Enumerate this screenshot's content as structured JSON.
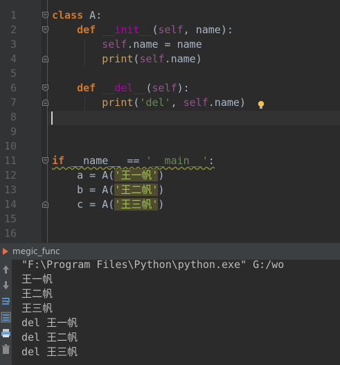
{
  "editor": {
    "line_numbers": [
      "1",
      "2",
      "3",
      "4",
      "5",
      "6",
      "7",
      "8",
      "9",
      "10",
      "11",
      "12",
      "13",
      "14",
      "15",
      "16"
    ],
    "line1": {
      "kw": "class",
      "rest": " A:"
    },
    "line2": {
      "kw": "def",
      "sp": " ",
      "magic": "__init__",
      "p1": "(",
      "self": "self",
      "rest": ", name):"
    },
    "line3": {
      "self": "self",
      "rest": ".name = name"
    },
    "line4": {
      "bi": "print",
      "p1": "(",
      "self": "self",
      "rest": ".name)"
    },
    "line6": {
      "kw": "def",
      "sp": " ",
      "magic": "__del__",
      "p1": "(",
      "self": "self",
      "rest": "):"
    },
    "line7": {
      "bi": "print",
      "p1": "(",
      "str": "'del'",
      "p2": ", ",
      "self": "self",
      "rest": ".name)"
    },
    "line11": {
      "kw": "if",
      "sp": " ",
      "dname": "__name__",
      "op": " == ",
      "str": "'__main__'",
      "rest": ":"
    },
    "line12": {
      "pre": "a = A(",
      "str": "'王一帆'",
      "rest": ")"
    },
    "line13": {
      "pre": "b = A(",
      "str": "'王二帆'",
      "rest": ")"
    },
    "line14": {
      "pre": "c = A(",
      "str": "'王三帆'",
      "rest": ")"
    }
  },
  "run": {
    "title": "megic_func",
    "output": [
      "\"F:\\Program Files\\Python\\python.exe\" G:/wo",
      "王一帆",
      "王二帆",
      "王三帆",
      "del 王一帆",
      "del 王二帆",
      "del 王三帆"
    ]
  },
  "icons": [
    "fold-marker-icon",
    "lightbulb-icon",
    "run-icon",
    "up-arrow-icon",
    "down-arrow-icon",
    "soft-wrap-icon",
    "scroll-to-end-icon",
    "print-icon",
    "trash-icon"
  ],
  "colors": {
    "keyword": "#cc7832",
    "magic": "#b200b2",
    "self": "#94558d",
    "string": "#6a8759",
    "text": "#a9b7c6",
    "builtin": "#cd9e57"
  }
}
